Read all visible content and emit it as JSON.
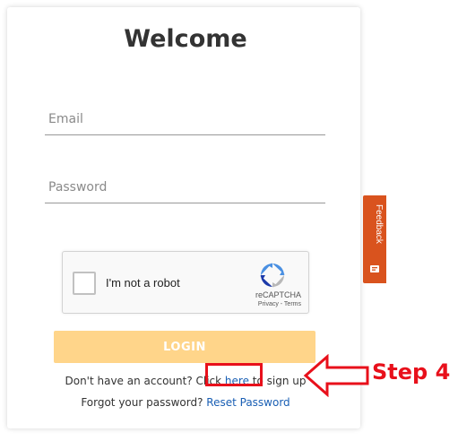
{
  "form": {
    "title": "Welcome",
    "email_placeholder": "Email",
    "password_placeholder": "Password",
    "login_label": "LOGIN",
    "signup_prefix": "Don't have an account? Click ",
    "signup_link": "here",
    "signup_suffix": " to sign up",
    "forgot_prefix": "Forgot your password? ",
    "forgot_link": "Reset Password"
  },
  "recaptcha": {
    "label": "I'm not a robot",
    "brand": "reCAPTCHA",
    "terms": "Privacy - Terms"
  },
  "feedback": {
    "label": "Feedback"
  },
  "annotation": {
    "step_label": "Step 4"
  },
  "colors": {
    "login_button": "#ffd58a",
    "link": "#1a5fb4",
    "annotation": "#e8101b",
    "feedback_tab": "#d9531e"
  },
  "icons": [
    "recaptcha-logo-icon",
    "feedback-icon",
    "arrow-icon"
  ]
}
